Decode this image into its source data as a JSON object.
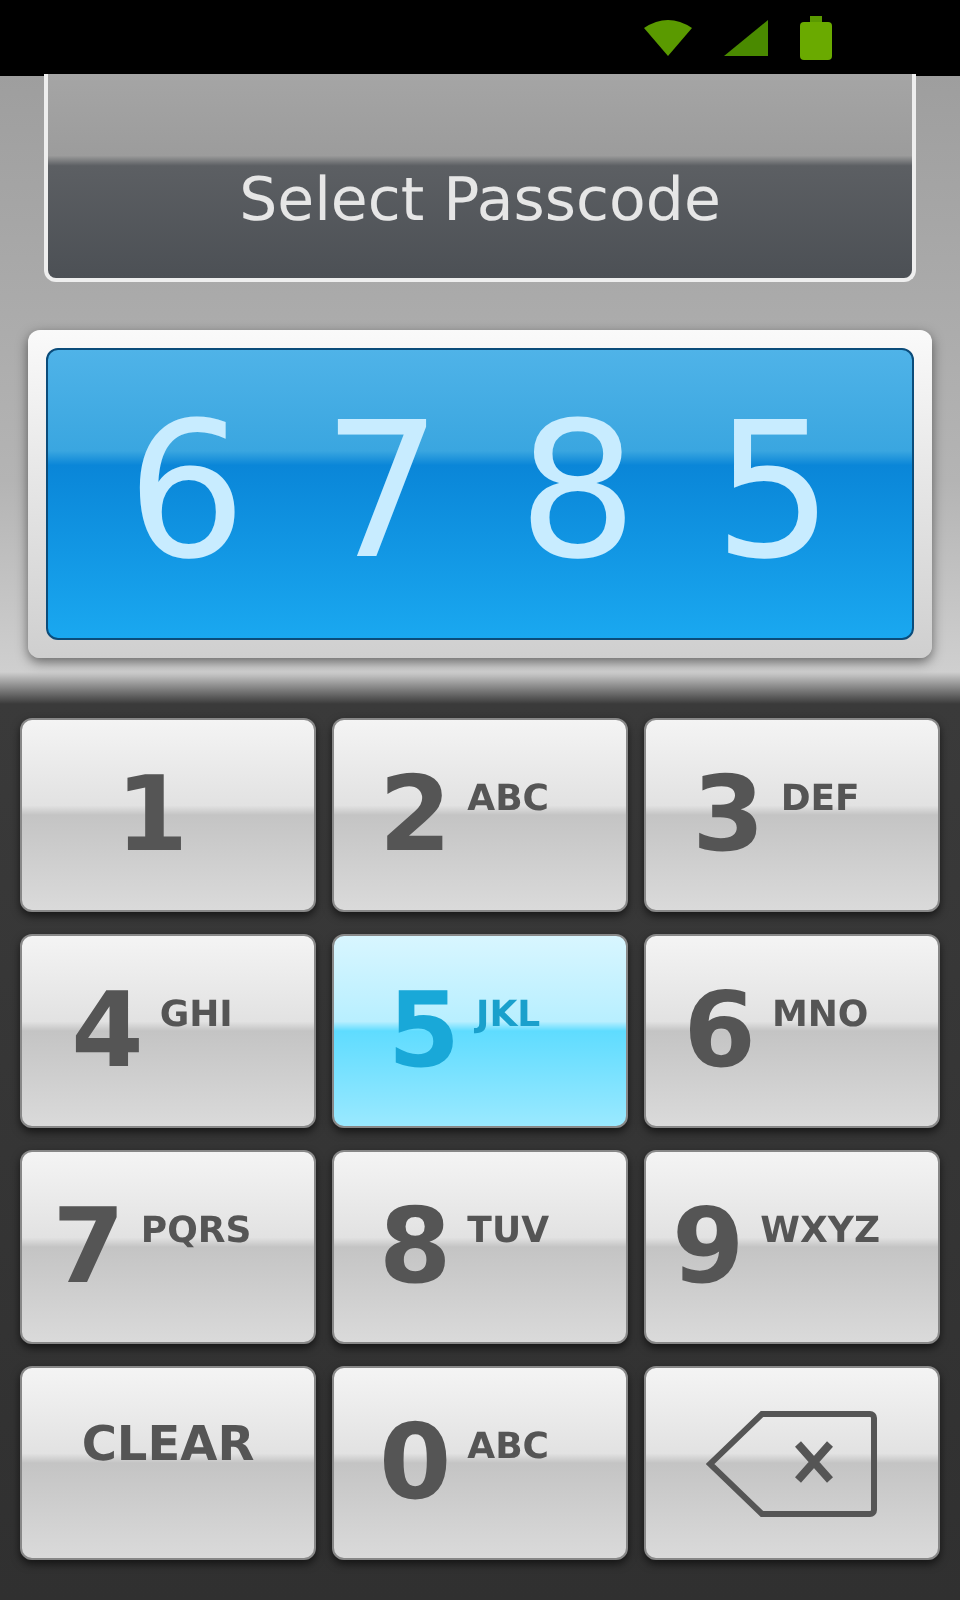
{
  "title": "Select Passcode",
  "passcode": [
    "6",
    "7",
    "8",
    "5"
  ],
  "keys": [
    {
      "kind": "digit",
      "digit": "1",
      "selected": false
    },
    {
      "kind": "digit",
      "digit": "2",
      "letters": "ABC",
      "selected": false
    },
    {
      "kind": "digit",
      "digit": "3",
      "letters": "DEF",
      "selected": false
    },
    {
      "kind": "digit",
      "digit": "4",
      "letters": "GHI",
      "selected": false
    },
    {
      "kind": "digit",
      "digit": "5",
      "letters": "JKL",
      "selected": true
    },
    {
      "kind": "digit",
      "digit": "6",
      "letters": "MNO",
      "selected": false
    },
    {
      "kind": "digit",
      "digit": "7",
      "letters": "PQRS",
      "selected": false
    },
    {
      "kind": "digit",
      "digit": "8",
      "letters": "TUV",
      "selected": false
    },
    {
      "kind": "digit",
      "digit": "9",
      "letters": "WXYZ",
      "selected": false
    },
    {
      "kind": "clear",
      "label": "CLEAR",
      "selected": false
    },
    {
      "kind": "digit",
      "digit": "0",
      "letters": "ABC",
      "selected": false
    },
    {
      "kind": "backspace",
      "selected": false
    }
  ]
}
